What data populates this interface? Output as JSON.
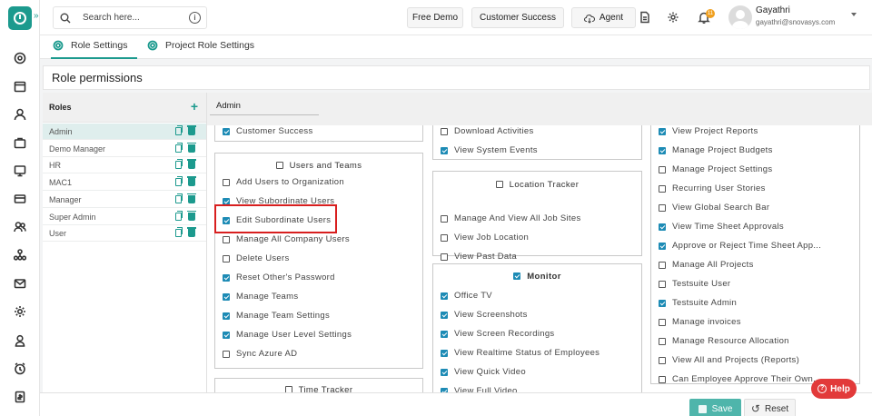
{
  "topbar": {
    "search_placeholder": "Search here...",
    "free_demo": "Free Demo",
    "customer_success": "Customer Success",
    "agent": "Agent",
    "notification_count": "11",
    "user_name": "Gayathri",
    "user_email": "gayathri@snovasys.com"
  },
  "tabs": [
    {
      "label": "Role Settings",
      "active": true
    },
    {
      "label": "Project Role Settings",
      "active": false
    }
  ],
  "page_title": "Role permissions",
  "roles": {
    "header": "Roles",
    "items": [
      "Admin",
      "Demo Manager",
      "HR",
      "MAC1",
      "Manager",
      "Super Admin",
      "User"
    ],
    "selected": "Admin"
  },
  "permissions": {
    "selected_role": "Admin",
    "col1_top": {
      "items": [
        {
          "label": "Customer Success",
          "checked": true
        }
      ]
    },
    "users_and_teams": {
      "title": "Users and Teams",
      "checked": false,
      "items": [
        {
          "label": "Add Users to Organization",
          "checked": false
        },
        {
          "label": "View Subordinate Users",
          "checked": true
        },
        {
          "label": "Edit Subordinate Users",
          "checked": true
        },
        {
          "label": "Manage All Company Users",
          "checked": false
        },
        {
          "label": "Delete Users",
          "checked": false
        },
        {
          "label": "Reset Other's Password",
          "checked": true
        },
        {
          "label": "Manage Teams",
          "checked": true
        },
        {
          "label": "Manage Team Settings",
          "checked": true
        },
        {
          "label": "Manage User Level Settings",
          "checked": true
        },
        {
          "label": "Sync Azure AD",
          "checked": false
        }
      ]
    },
    "time_tracker": {
      "title": "Time Tracker",
      "checked": false
    },
    "col2_top": {
      "items": [
        {
          "label": "Download Activities",
          "checked": false
        },
        {
          "label": "View System Events",
          "checked": true
        }
      ]
    },
    "location_tracker": {
      "title": "Location Tracker",
      "checked": false,
      "items": [
        {
          "label": "Manage And View All Job Sites",
          "checked": false
        },
        {
          "label": "View Job Location",
          "checked": false
        },
        {
          "label": "View Past Data",
          "checked": false
        }
      ]
    },
    "monitor": {
      "title": "Monitor",
      "checked": true,
      "items": [
        {
          "label": "Office TV",
          "checked": true
        },
        {
          "label": "View Screenshots",
          "checked": true
        },
        {
          "label": "View Screen Recordings",
          "checked": true
        },
        {
          "label": "View Realtime Status of Employees",
          "checked": true
        },
        {
          "label": "View Quick Video",
          "checked": true
        },
        {
          "label": "View Full Video",
          "checked": true
        }
      ]
    },
    "col3": {
      "items": [
        {
          "label": "View Project Reports",
          "checked": true
        },
        {
          "label": "Manage Project Budgets",
          "checked": true
        },
        {
          "label": "Manage Project Settings",
          "checked": false
        },
        {
          "label": "Recurring User Stories",
          "checked": false
        },
        {
          "label": "View Global Search Bar",
          "checked": false
        },
        {
          "label": "View Time Sheet Approvals",
          "checked": true
        },
        {
          "label": "Approve or Reject Time Sheet App...",
          "checked": true
        },
        {
          "label": "Manage All Projects",
          "checked": false
        },
        {
          "label": "Testsuite User",
          "checked": false
        },
        {
          "label": "Testsuite Admin",
          "checked": true
        },
        {
          "label": "Manage invoices",
          "checked": false
        },
        {
          "label": "Manage Resource Allocation",
          "checked": false
        },
        {
          "label": "View All and Projects (Reports)",
          "checked": false
        },
        {
          "label": "Can Employee Approve Their Own...",
          "checked": false
        }
      ]
    }
  },
  "footer": {
    "save": "Save",
    "reset": "Reset"
  },
  "help": "Help",
  "colors": {
    "accent": "#1c9a8e",
    "checkbox": "#1d8bb5",
    "highlight": "#d81f1f",
    "help": "#e23a3a"
  }
}
